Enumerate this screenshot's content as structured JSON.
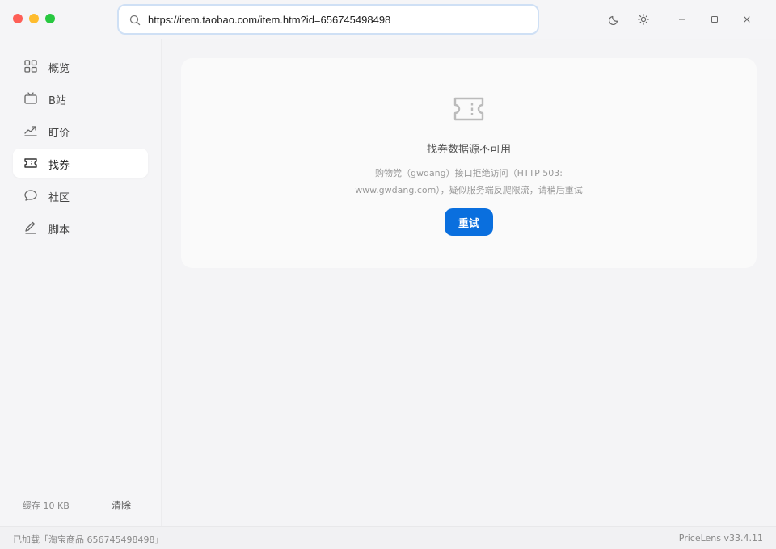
{
  "titlebar": {
    "address": "https://item.taobao.com/item.htm?id=656745498498"
  },
  "icons": {
    "search": "search-icon",
    "theme": "moon-icon",
    "settings": "sun-gear-icon",
    "minimize": "minimize-icon",
    "maximize": "maximize-icon",
    "close": "close-icon"
  },
  "sidebar": {
    "items": [
      {
        "label": "概览",
        "icon": "grid-icon"
      },
      {
        "label": "B站",
        "icon": "tv-icon"
      },
      {
        "label": "盯价",
        "icon": "trend-icon"
      },
      {
        "label": "找券",
        "icon": "ticket-icon",
        "active": true
      },
      {
        "label": "社区",
        "icon": "chat-icon"
      },
      {
        "label": "脚本",
        "icon": "pen-icon"
      }
    ],
    "cache_label": "缓存 10 KB",
    "clear_label": "清除"
  },
  "main": {
    "error_title": "找券数据源不可用",
    "error_desc": "购物党（gwdang）接口拒绝访问（HTTP 503: www.gwdang.com），疑似服务端反爬限流，请稍后重试",
    "retry_label": "重试"
  },
  "statusbar": {
    "left": "已加载「淘宝商品 656745498498」",
    "right": "PriceLens v33.4.11"
  },
  "colors": {
    "accent": "#0a6fde",
    "address_border": "#cfe0f5"
  }
}
